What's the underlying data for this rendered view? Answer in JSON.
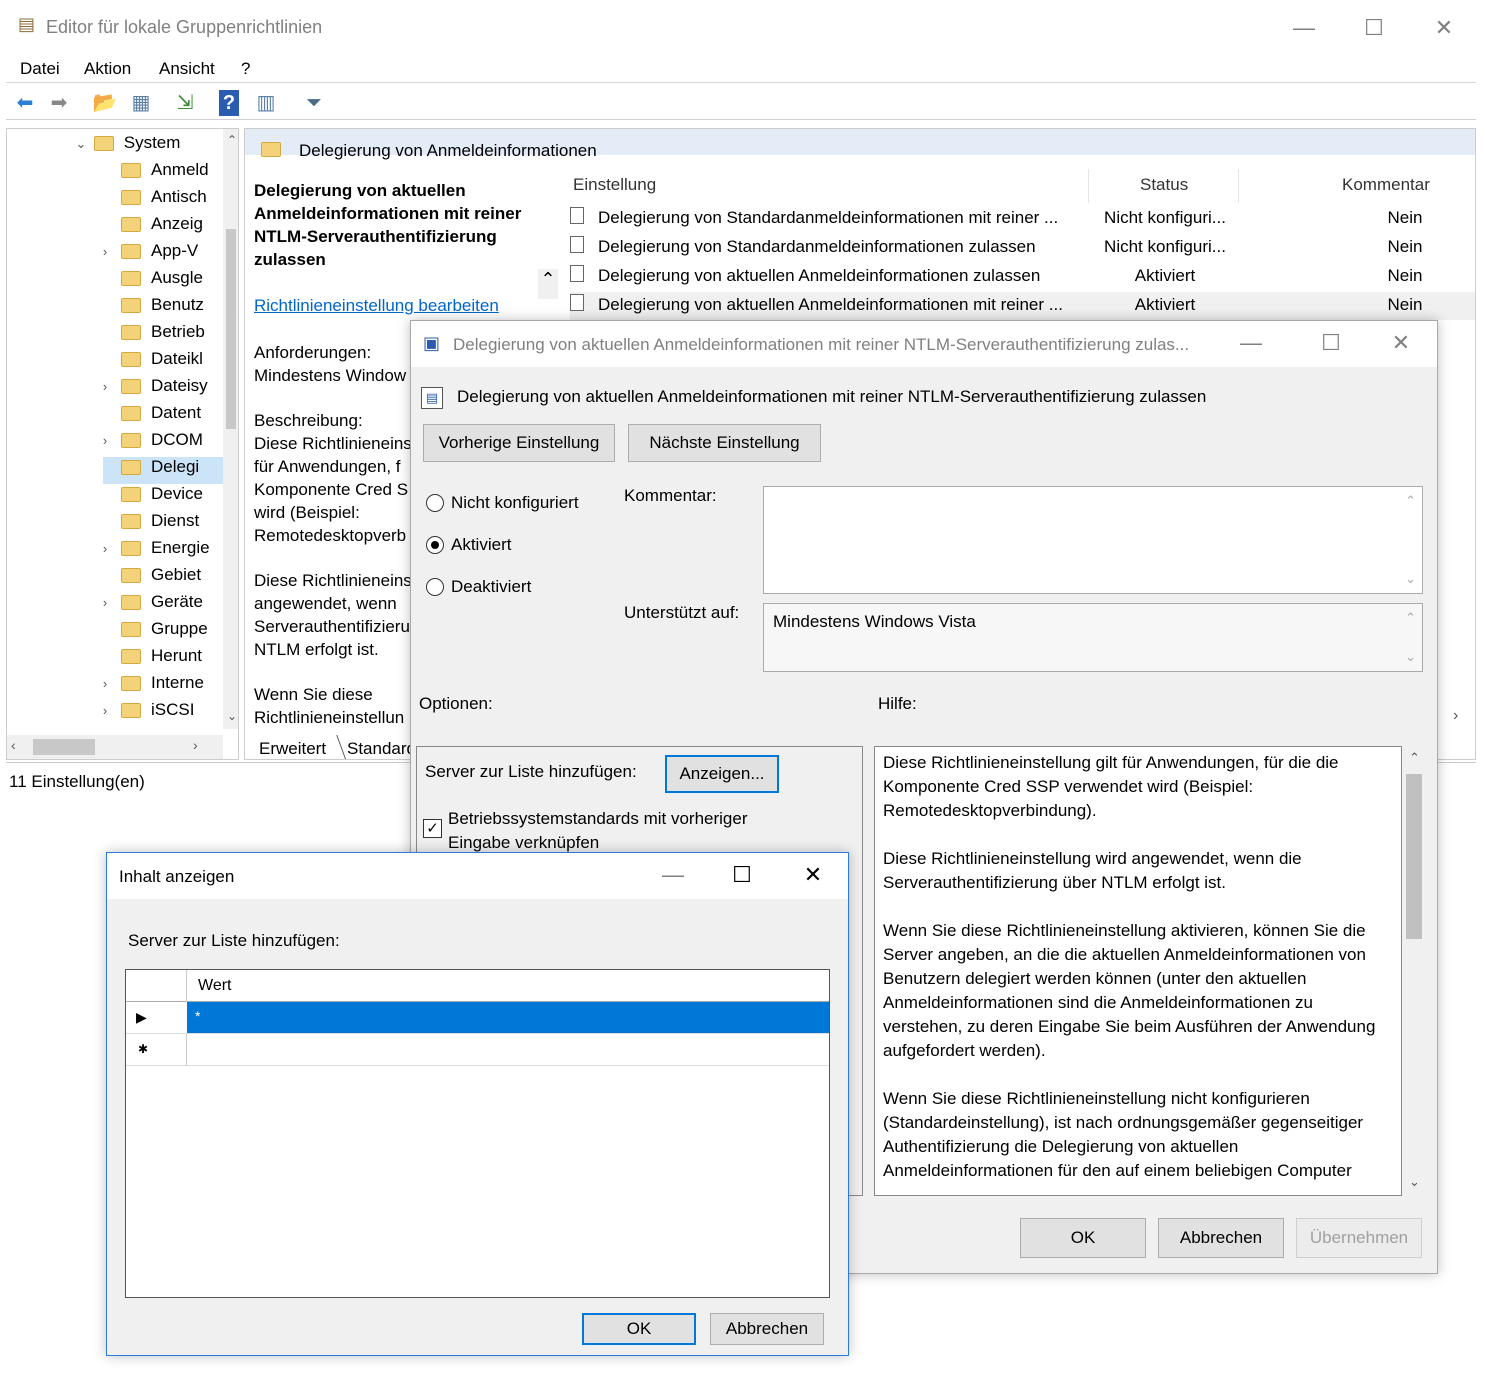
{
  "main": {
    "title": "Editor für lokale Gruppenrichtlinien",
    "menu": [
      "Datei",
      "Aktion",
      "Ansicht",
      "?"
    ],
    "tree": {
      "root": "System",
      "items": [
        "Anmeld",
        "Antisch",
        "Anzeig",
        "App-V",
        "Ausgle",
        "Benutz",
        "Betrieb",
        "Dateikl",
        "Dateisy",
        "Datent",
        "DCOM",
        "Delegi",
        "Device",
        "Dienst",
        "Energie",
        "Gebiet",
        "Geräte",
        "Gruppe",
        "Herunt",
        "Interne",
        "iSCSI"
      ]
    },
    "header_band": "Delegierung von Anmeldeinformationen",
    "detail": {
      "title": "Delegierung von aktuellen Anmeldeinformationen mit reiner NTLM-Serverauthentifizierung zulassen",
      "edit_link": "Richtlinieneinstellung bearbeiten",
      "requirements_label": "Anforderungen:",
      "requirements_value": "Mindestens Window",
      "description_label": "Beschreibung:",
      "desc1": "Diese Richtlinieneins",
      "desc2": "für Anwendungen, f",
      "desc3": "Komponente Cred S",
      "desc4": "wird (Beispiel:",
      "desc5": "Remotedesktopverb",
      "desc6": "Diese Richtlinieneins",
      "desc7": "angewendet, wenn",
      "desc8": "Serverauthentifizieru",
      "desc9": "NTLM erfolgt ist.",
      "desc10": "Wenn Sie diese",
      "desc11": "Richtlinieneinstellun"
    },
    "columns": {
      "setting": "Einstellung",
      "status": "Status",
      "comment": "Kommentar"
    },
    "rows": [
      {
        "setting": "Delegierung von Standardanmeldeinformationen mit reiner ...",
        "status": "Nicht konfiguri...",
        "comment": "Nein"
      },
      {
        "setting": "Delegierung von Standardanmeldeinformationen zulassen",
        "status": "Nicht konfiguri...",
        "comment": "Nein"
      },
      {
        "setting": "Delegierung von aktuellen Anmeldeinformationen zulassen",
        "status": "Aktiviert",
        "comment": "Nein"
      },
      {
        "setting": "Delegierung von aktuellen Anmeldeinformationen mit reiner ...",
        "status": "Aktiviert",
        "comment": "Nein"
      }
    ],
    "tabs": [
      "Erweitert",
      "Standard"
    ],
    "status_text": "11 Einstellung(en)"
  },
  "dialog1": {
    "title": "Delegierung von aktuellen Anmeldeinformationen mit reiner NTLM-Serverauthentifizierung zulas...",
    "policy_name": "Delegierung von aktuellen Anmeldeinformationen mit reiner NTLM-Serverauthentifizierung zulassen",
    "prev_button": "Vorherige Einstellung",
    "next_button": "Nächste Einstellung",
    "radio_not_configured": "Nicht konfiguriert",
    "radio_enabled": "Aktiviert",
    "radio_disabled": "Deaktiviert",
    "selected_option": "Aktiviert",
    "comment_label": "Kommentar:",
    "supported_label": "Unterstützt auf:",
    "supported_value": "Mindestens Windows Vista",
    "options_label": "Optionen:",
    "help_label": "Hilfe:",
    "server_list_label": "Server zur Liste hinzufügen:",
    "show_button": "Anzeigen...",
    "checkbox_label_1": "Betriebssystemstandards mit vorheriger",
    "checkbox_label_2": "Eingabe verknüpfen",
    "checkbox_checked": true,
    "help_p1": "Diese Richtlinieneinstellung gilt für Anwendungen, für die die Komponente Cred SSP verwendet wird (Beispiel: Remotedesktopverbindung).",
    "help_p2": "Diese Richtlinieneinstellung wird angewendet, wenn die Serverauthentifizierung über NTLM erfolgt ist.",
    "help_p3": "Wenn Sie diese Richtlinieneinstellung aktivieren, können Sie die Server angeben, an die die aktuellen Anmeldeinformationen von Benutzern delegiert werden können (unter den aktuellen Anmeldeinformationen sind die Anmeldeinformationen zu verstehen, zu deren Eingabe Sie beim Ausführen der Anwendung aufgefordert werden).",
    "help_p4": "Wenn Sie diese Richtlinieneinstellung nicht konfigurieren (Standardeinstellung), ist nach ordnungsgemäßer gegenseitiger Authentifizierung die Delegierung von aktuellen Anmeldeinformationen für den auf einem beliebigen Computer",
    "ok_button": "OK",
    "cancel_button": "Abbrechen",
    "apply_button": "Übernehmen"
  },
  "dialog2": {
    "title": "Inhalt anzeigen",
    "label": "Server zur Liste hinzufügen:",
    "column_value": "Wert",
    "rows": [
      "*",
      ""
    ],
    "ok_button": "OK",
    "cancel_button": "Abbrechen"
  },
  "colors": {
    "selection": "#0078d7",
    "header_band": "#e3ecf7",
    "link": "#0066cc",
    "dialog_bg": "#f0f0f0"
  }
}
